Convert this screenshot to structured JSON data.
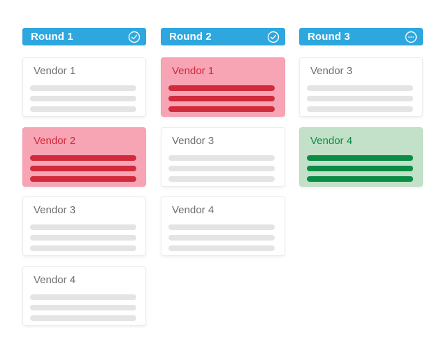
{
  "colors": {
    "header_bg": "#2ea7df",
    "header_text": "#ffffff",
    "neutral_card_bg": "#ffffff",
    "neutral_line": "#e4e4e4",
    "neutral_text": "#6e6e6e",
    "rejected_bg": "#f7a4b4",
    "rejected_accent": "#d02a3b",
    "selected_bg": "#c2e1c8",
    "selected_accent": "#0b8c45"
  },
  "rounds": [
    {
      "title": "Round 1",
      "status_icon": "check-circle-icon",
      "status": "complete",
      "vendors": [
        {
          "name": "Vendor 1",
          "state": "neutral"
        },
        {
          "name": "Vendor 2",
          "state": "rejected"
        },
        {
          "name": "Vendor 3",
          "state": "neutral"
        },
        {
          "name": "Vendor 4",
          "state": "neutral"
        }
      ]
    },
    {
      "title": "Round 2",
      "status_icon": "check-circle-icon",
      "status": "complete",
      "vendors": [
        {
          "name": "Vendor 1",
          "state": "rejected"
        },
        {
          "name": "Vendor 3",
          "state": "neutral"
        },
        {
          "name": "Vendor 4",
          "state": "neutral"
        }
      ]
    },
    {
      "title": "Round 3",
      "status_icon": "more-circle-icon",
      "status": "in-progress",
      "vendors": [
        {
          "name": "Vendor 3",
          "state": "neutral"
        },
        {
          "name": "Vendor 4",
          "state": "selected"
        }
      ]
    }
  ]
}
